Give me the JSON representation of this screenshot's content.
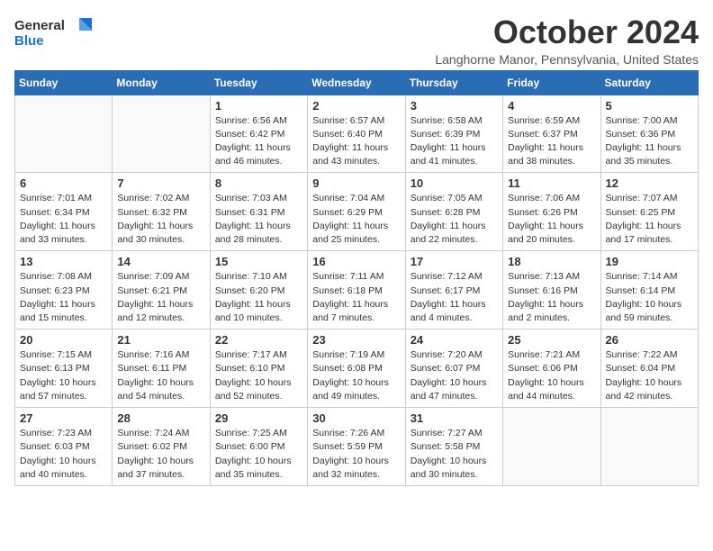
{
  "header": {
    "logo_general": "General",
    "logo_blue": "Blue",
    "month_title": "October 2024",
    "subtitle": "Langhorne Manor, Pennsylvania, United States"
  },
  "weekdays": [
    "Sunday",
    "Monday",
    "Tuesday",
    "Wednesday",
    "Thursday",
    "Friday",
    "Saturday"
  ],
  "weeks": [
    [
      {
        "day": "",
        "info": ""
      },
      {
        "day": "",
        "info": ""
      },
      {
        "day": "1",
        "info": "Sunrise: 6:56 AM\nSunset: 6:42 PM\nDaylight: 11 hours and 46 minutes."
      },
      {
        "day": "2",
        "info": "Sunrise: 6:57 AM\nSunset: 6:40 PM\nDaylight: 11 hours and 43 minutes."
      },
      {
        "day": "3",
        "info": "Sunrise: 6:58 AM\nSunset: 6:39 PM\nDaylight: 11 hours and 41 minutes."
      },
      {
        "day": "4",
        "info": "Sunrise: 6:59 AM\nSunset: 6:37 PM\nDaylight: 11 hours and 38 minutes."
      },
      {
        "day": "5",
        "info": "Sunrise: 7:00 AM\nSunset: 6:36 PM\nDaylight: 11 hours and 35 minutes."
      }
    ],
    [
      {
        "day": "6",
        "info": "Sunrise: 7:01 AM\nSunset: 6:34 PM\nDaylight: 11 hours and 33 minutes."
      },
      {
        "day": "7",
        "info": "Sunrise: 7:02 AM\nSunset: 6:32 PM\nDaylight: 11 hours and 30 minutes."
      },
      {
        "day": "8",
        "info": "Sunrise: 7:03 AM\nSunset: 6:31 PM\nDaylight: 11 hours and 28 minutes."
      },
      {
        "day": "9",
        "info": "Sunrise: 7:04 AM\nSunset: 6:29 PM\nDaylight: 11 hours and 25 minutes."
      },
      {
        "day": "10",
        "info": "Sunrise: 7:05 AM\nSunset: 6:28 PM\nDaylight: 11 hours and 22 minutes."
      },
      {
        "day": "11",
        "info": "Sunrise: 7:06 AM\nSunset: 6:26 PM\nDaylight: 11 hours and 20 minutes."
      },
      {
        "day": "12",
        "info": "Sunrise: 7:07 AM\nSunset: 6:25 PM\nDaylight: 11 hours and 17 minutes."
      }
    ],
    [
      {
        "day": "13",
        "info": "Sunrise: 7:08 AM\nSunset: 6:23 PM\nDaylight: 11 hours and 15 minutes."
      },
      {
        "day": "14",
        "info": "Sunrise: 7:09 AM\nSunset: 6:21 PM\nDaylight: 11 hours and 12 minutes."
      },
      {
        "day": "15",
        "info": "Sunrise: 7:10 AM\nSunset: 6:20 PM\nDaylight: 11 hours and 10 minutes."
      },
      {
        "day": "16",
        "info": "Sunrise: 7:11 AM\nSunset: 6:18 PM\nDaylight: 11 hours and 7 minutes."
      },
      {
        "day": "17",
        "info": "Sunrise: 7:12 AM\nSunset: 6:17 PM\nDaylight: 11 hours and 4 minutes."
      },
      {
        "day": "18",
        "info": "Sunrise: 7:13 AM\nSunset: 6:16 PM\nDaylight: 11 hours and 2 minutes."
      },
      {
        "day": "19",
        "info": "Sunrise: 7:14 AM\nSunset: 6:14 PM\nDaylight: 10 hours and 59 minutes."
      }
    ],
    [
      {
        "day": "20",
        "info": "Sunrise: 7:15 AM\nSunset: 6:13 PM\nDaylight: 10 hours and 57 minutes."
      },
      {
        "day": "21",
        "info": "Sunrise: 7:16 AM\nSunset: 6:11 PM\nDaylight: 10 hours and 54 minutes."
      },
      {
        "day": "22",
        "info": "Sunrise: 7:17 AM\nSunset: 6:10 PM\nDaylight: 10 hours and 52 minutes."
      },
      {
        "day": "23",
        "info": "Sunrise: 7:19 AM\nSunset: 6:08 PM\nDaylight: 10 hours and 49 minutes."
      },
      {
        "day": "24",
        "info": "Sunrise: 7:20 AM\nSunset: 6:07 PM\nDaylight: 10 hours and 47 minutes."
      },
      {
        "day": "25",
        "info": "Sunrise: 7:21 AM\nSunset: 6:06 PM\nDaylight: 10 hours and 44 minutes."
      },
      {
        "day": "26",
        "info": "Sunrise: 7:22 AM\nSunset: 6:04 PM\nDaylight: 10 hours and 42 minutes."
      }
    ],
    [
      {
        "day": "27",
        "info": "Sunrise: 7:23 AM\nSunset: 6:03 PM\nDaylight: 10 hours and 40 minutes."
      },
      {
        "day": "28",
        "info": "Sunrise: 7:24 AM\nSunset: 6:02 PM\nDaylight: 10 hours and 37 minutes."
      },
      {
        "day": "29",
        "info": "Sunrise: 7:25 AM\nSunset: 6:00 PM\nDaylight: 10 hours and 35 minutes."
      },
      {
        "day": "30",
        "info": "Sunrise: 7:26 AM\nSunset: 5:59 PM\nDaylight: 10 hours and 32 minutes."
      },
      {
        "day": "31",
        "info": "Sunrise: 7:27 AM\nSunset: 5:58 PM\nDaylight: 10 hours and 30 minutes."
      },
      {
        "day": "",
        "info": ""
      },
      {
        "day": "",
        "info": ""
      }
    ]
  ]
}
